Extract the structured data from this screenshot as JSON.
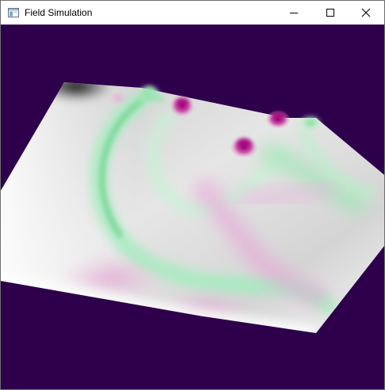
{
  "window": {
    "title": "Field Simulation",
    "app_icon": "window-app-icon",
    "controls": {
      "minimize_icon": "minimize-icon",
      "maximize_icon": "maximize-icon",
      "close_icon": "close-icon"
    }
  },
  "scene": {
    "background_color": "#2e004c",
    "surface_colors": {
      "base": "#d9d9d9",
      "highlight": "#ffffff",
      "shadow": "#000000",
      "peak_magenta": "#b0108a",
      "ridge_green": "#8fe3a8"
    }
  }
}
